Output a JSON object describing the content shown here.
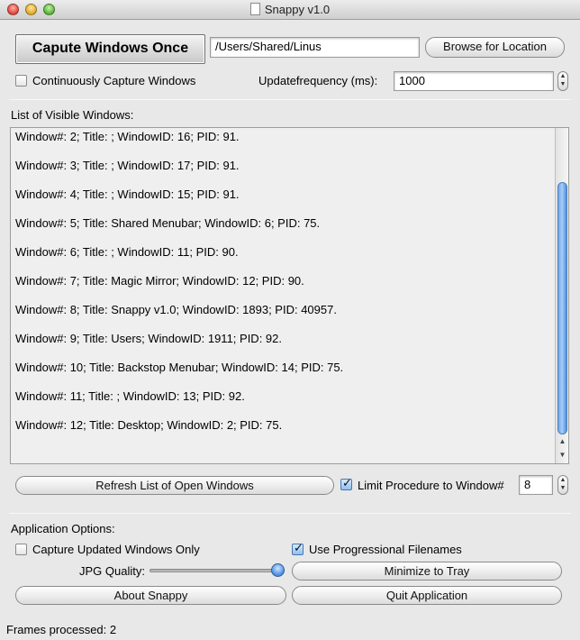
{
  "window": {
    "title": "Snappy v1.0"
  },
  "capture": {
    "capture_once_label": "Capute Windows Once",
    "location_value": "/Users/Shared/Linus",
    "browse_label": "Browse for Location",
    "continuous_label": "Continuously Capture Windows",
    "continuous_checked": false,
    "update_freq_label": "Updatefrequency (ms):",
    "update_freq_value": "1000"
  },
  "list": {
    "header": "List of Visible Windows:",
    "items": [
      "Window#: 2; Title: ; WindowID: 16; PID: 91.",
      "Window#: 3; Title: ; WindowID: 17; PID: 91.",
      "Window#: 4; Title: ; WindowID: 15; PID: 91.",
      "Window#: 5; Title: Shared Menubar; WindowID: 6; PID: 75.",
      "Window#: 6; Title: ; WindowID: 11; PID: 90.",
      "Window#: 7; Title: Magic Mirror; WindowID: 12; PID: 90.",
      "Window#: 8; Title: Snappy v1.0; WindowID: 1893; PID: 40957.",
      "Window#: 9; Title: Users; WindowID: 1911; PID: 92.",
      "Window#: 10; Title: Backstop Menubar; WindowID: 14; PID: 75.",
      "Window#: 11; Title: ; WindowID: 13; PID: 92.",
      "Window#: 12; Title: Desktop; WindowID: 2; PID: 75."
    ]
  },
  "refresh": {
    "refresh_label": "Refresh List of Open Windows",
    "limit_label": "Limit Procedure to Window#",
    "limit_checked": true,
    "limit_value": "8"
  },
  "options": {
    "header": "Application Options:",
    "capture_updated_label": "Capture Updated Windows Only",
    "capture_updated_checked": false,
    "progressional_label": "Use Progressional Filenames",
    "progressional_checked": true,
    "jpg_quality_label": "JPG Quality:",
    "jpg_quality_fraction": 0.95,
    "minimize_label": "Minimize to Tray",
    "about_label": "About Snappy",
    "quit_label": "Quit Application"
  },
  "status": {
    "frames_processed": "Frames processed: 2"
  },
  "colors": {
    "accent": "#5a97e2",
    "window_bg": "#e8e8e8",
    "list_bg": "#efefef"
  },
  "icons": {
    "close": "close-icon",
    "minimize": "minimize-icon",
    "zoom": "zoom-icon",
    "document": "document-icon",
    "checkmark": "checkmark-icon",
    "stepper_up": "chevron-up-icon",
    "stepper_down": "chevron-down-icon"
  }
}
